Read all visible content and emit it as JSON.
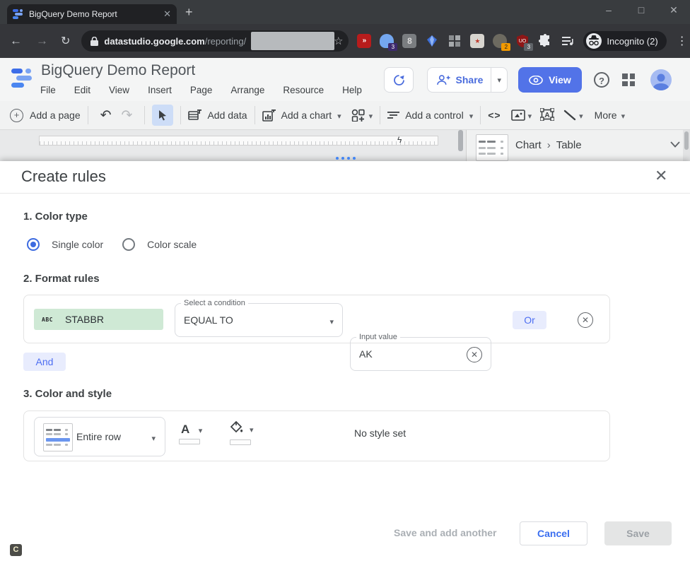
{
  "browser": {
    "tab": {
      "title": "BigQuery Demo Report"
    },
    "address": {
      "domain": "datastudio.google.com",
      "path": "/reporting/"
    },
    "incognito": "Incognito (2)",
    "ext_badges": {
      "ghost": "3",
      "clock": "2",
      "shield": "3"
    }
  },
  "header": {
    "title": "BigQuery Demo Report",
    "menus": [
      "File",
      "Edit",
      "View",
      "Insert",
      "Page",
      "Arrange",
      "Resource",
      "Help"
    ],
    "share": "Share",
    "view": "View"
  },
  "toolbar": {
    "add_page": "Add a page",
    "add_data": "Add data",
    "add_chart": "Add a chart",
    "add_control": "Add a control",
    "more": "More",
    "embed_glyph": "<>"
  },
  "panel": {
    "chart": "Chart",
    "sep": "›",
    "type": "Table"
  },
  "modal": {
    "title": "Create rules",
    "color_type": {
      "heading": "1. Color type",
      "single": "Single color",
      "scale": "Color scale"
    },
    "format_rules": {
      "heading": "2. Format rules",
      "field_type": "ABC",
      "field": "STABBR",
      "condition_label": "Select a condition",
      "condition_value": "EQUAL TO",
      "input_label": "Input value",
      "input_value": "AK",
      "or": "Or",
      "and": "And"
    },
    "color_style": {
      "heading": "3. Color and style",
      "apply_to": "Entire row",
      "text_glyph": "A",
      "no_style": "No style set"
    },
    "footer": {
      "save_add": "Save and add another",
      "cancel": "Cancel",
      "save": "Save"
    }
  },
  "misc": {
    "help_glyph": "?",
    "c_badge": "C"
  },
  "colors": {
    "accent_blue": "#5273e8",
    "link_blue": "#4a6cdd",
    "chip_green": "#cfe9d5",
    "chip_lavender": "#e8ecfd",
    "chip_text": "#4d6ef2",
    "radio_blue": "#3d6be0"
  }
}
